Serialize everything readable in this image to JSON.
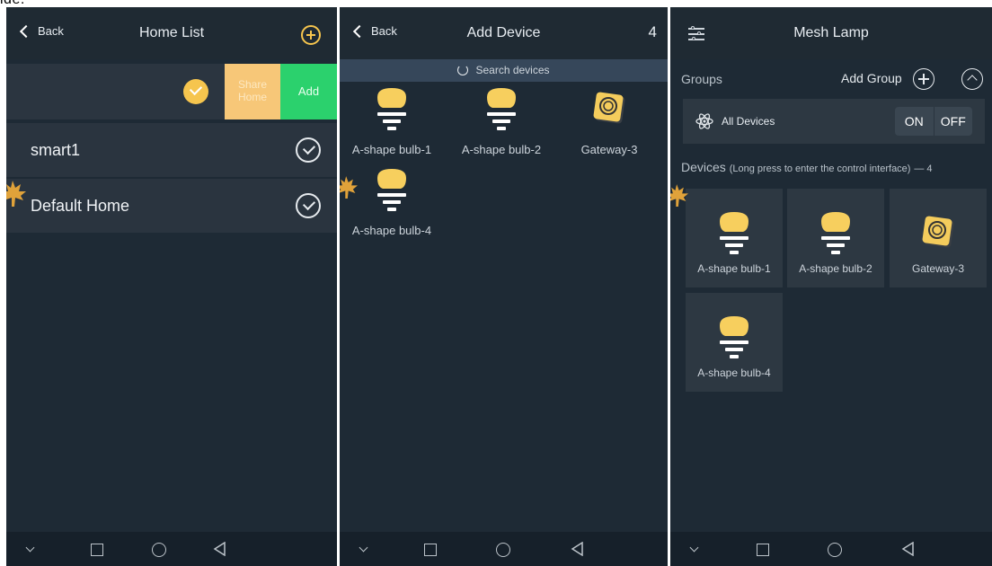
{
  "top_text": "ide.",
  "panel1": {
    "back_label": "Back",
    "title": "Home List",
    "share_label": "Share Home",
    "add_label": "Add",
    "homes": [
      {
        "name": "smart1"
      },
      {
        "name": "Default Home"
      }
    ]
  },
  "panel2": {
    "back_label": "Back",
    "title": "Add Device",
    "count": "4",
    "search_label": "Search devices",
    "devices": [
      {
        "label": "A-shape bulb-1",
        "icon": "bulb-icon"
      },
      {
        "label": "A-shape bulb-2",
        "icon": "bulb-icon"
      },
      {
        "label": "Gateway-3",
        "icon": "gateway-icon"
      },
      {
        "label": "A-shape bulb-4",
        "icon": "bulb-icon"
      }
    ]
  },
  "panel3": {
    "title": "Mesh Lamp",
    "groups_label": "Groups",
    "add_group_label": "Add Group",
    "all_devices_label": "All Devices",
    "on_label": "ON",
    "off_label": "OFF",
    "devices_label": "Devices",
    "devices_hint": "(Long press to enter the control interface)",
    "devices_count": "— 4",
    "devices": [
      {
        "label": "A-shape bulb-1",
        "icon": "bulb-icon"
      },
      {
        "label": "A-shape bulb-2",
        "icon": "bulb-icon"
      },
      {
        "label": "Gateway-3",
        "icon": "gateway-icon"
      },
      {
        "label": "A-shape bulb-4",
        "icon": "bulb-icon"
      }
    ]
  },
  "colors": {
    "background": "#1e2a35",
    "accent_gold": "#f6c54e",
    "share_orange": "#f7c778",
    "add_green": "#2bd16d"
  }
}
